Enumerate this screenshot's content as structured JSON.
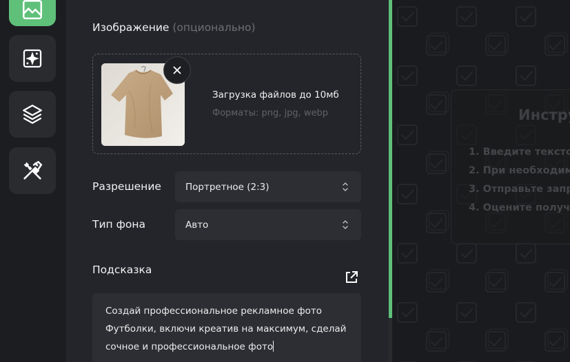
{
  "sidebar": {
    "items": [
      {
        "icon": "image-icon",
        "active": true
      },
      {
        "icon": "sparkle-image-icon",
        "active": false
      },
      {
        "icon": "layers-icon",
        "active": false
      },
      {
        "icon": "tools-icon",
        "active": false
      }
    ]
  },
  "image_section": {
    "label": "Изображение",
    "optional": "(опционально)",
    "upload_title": "Загрузка файлов до 10мб",
    "upload_formats": "Форматы: png, jpg, webp"
  },
  "resolution": {
    "label": "Разрешение",
    "value": "Портретное (2:3)"
  },
  "background": {
    "label": "Тип фона",
    "value": "Авто"
  },
  "prompt": {
    "label": "Подсказка",
    "lines": [
      "Создай профессиональное рекламное фото",
      "Футболки, включи креатив на максимум, сделай",
      "сочное и профессиональное фото"
    ]
  },
  "instructions": {
    "title": "Инстру",
    "steps": [
      "1. Введите тексто",
      "2. При необходим",
      "3. Отправьте запр",
      "4. Оцените получе"
    ]
  },
  "colors": {
    "accent": "#5fc07a",
    "panel": "#24252a",
    "input": "#2d2e33"
  }
}
